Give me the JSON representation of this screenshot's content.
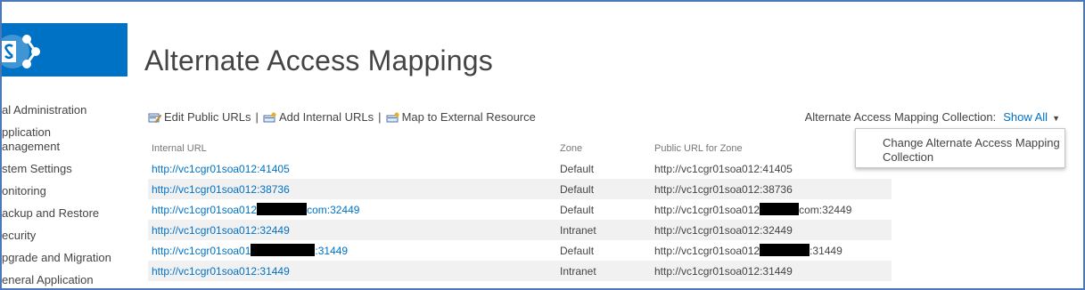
{
  "page": {
    "title": "Alternate Access Mappings"
  },
  "sidebar": {
    "items": [
      {
        "label": "al Administration"
      },
      {
        "label": "pplication"
      },
      {
        "label": "anagement"
      },
      {
        "label": "stem Settings"
      },
      {
        "label": "onitoring"
      },
      {
        "label": "ackup and Restore"
      },
      {
        "label": "ecurity"
      },
      {
        "label": "pgrade and Migration"
      },
      {
        "label": "eneral Application"
      }
    ]
  },
  "toolbar": {
    "edit_public_urls": "Edit Public URLs",
    "add_internal_urls": "Add Internal URLs",
    "map_external": "Map to External Resource",
    "separator": "|"
  },
  "collection": {
    "label": "Alternate Access Mapping Collection:",
    "value": "Show All",
    "menu_item": "Change Alternate Access Mapping Collection"
  },
  "table": {
    "headers": [
      "Internal URL",
      "Zone",
      "Public URL for Zone"
    ],
    "rows": [
      {
        "internal": "http://vc1cgr01soa012:41405",
        "zone": "Default",
        "public": "http://vc1cgr01soa012:41405"
      },
      {
        "internal": "http://vc1cgr01soa012:38736",
        "zone": "Default",
        "public": "http://vc1cgr01soa012:38736"
      },
      {
        "internal_pre": "http://vc1cgr01soa012",
        "internal_post": "com:32449",
        "zone": "Default",
        "public_pre": "http://vc1cgr01soa012",
        "public_post": "com:32449"
      },
      {
        "internal": "http://vc1cgr01soa012:32449",
        "zone": "Intranet",
        "public": "http://vc1cgr01soa012:32449"
      },
      {
        "internal_pre": "http://vc1cgr01soa01",
        "internal_post": ":31449",
        "zone": "Default",
        "public_pre": "http://vc1cgr01soa012",
        "public_post": ":31449"
      },
      {
        "internal": "http://vc1cgr01soa012:31449",
        "zone": "Intranet",
        "public": "http://vc1cgr01soa012:31449"
      }
    ]
  },
  "icons": {
    "logo": "sharepoint-logo-icon",
    "edit": "edit-urls-icon",
    "add": "add-internal-urls-icon",
    "map": "map-external-resource-icon",
    "caret": "caret-down-icon"
  },
  "colors": {
    "brand": "#0072c6",
    "link": "#0072c6",
    "frame_border": "#4a78b8",
    "row_alt": "#f1f1f1"
  }
}
